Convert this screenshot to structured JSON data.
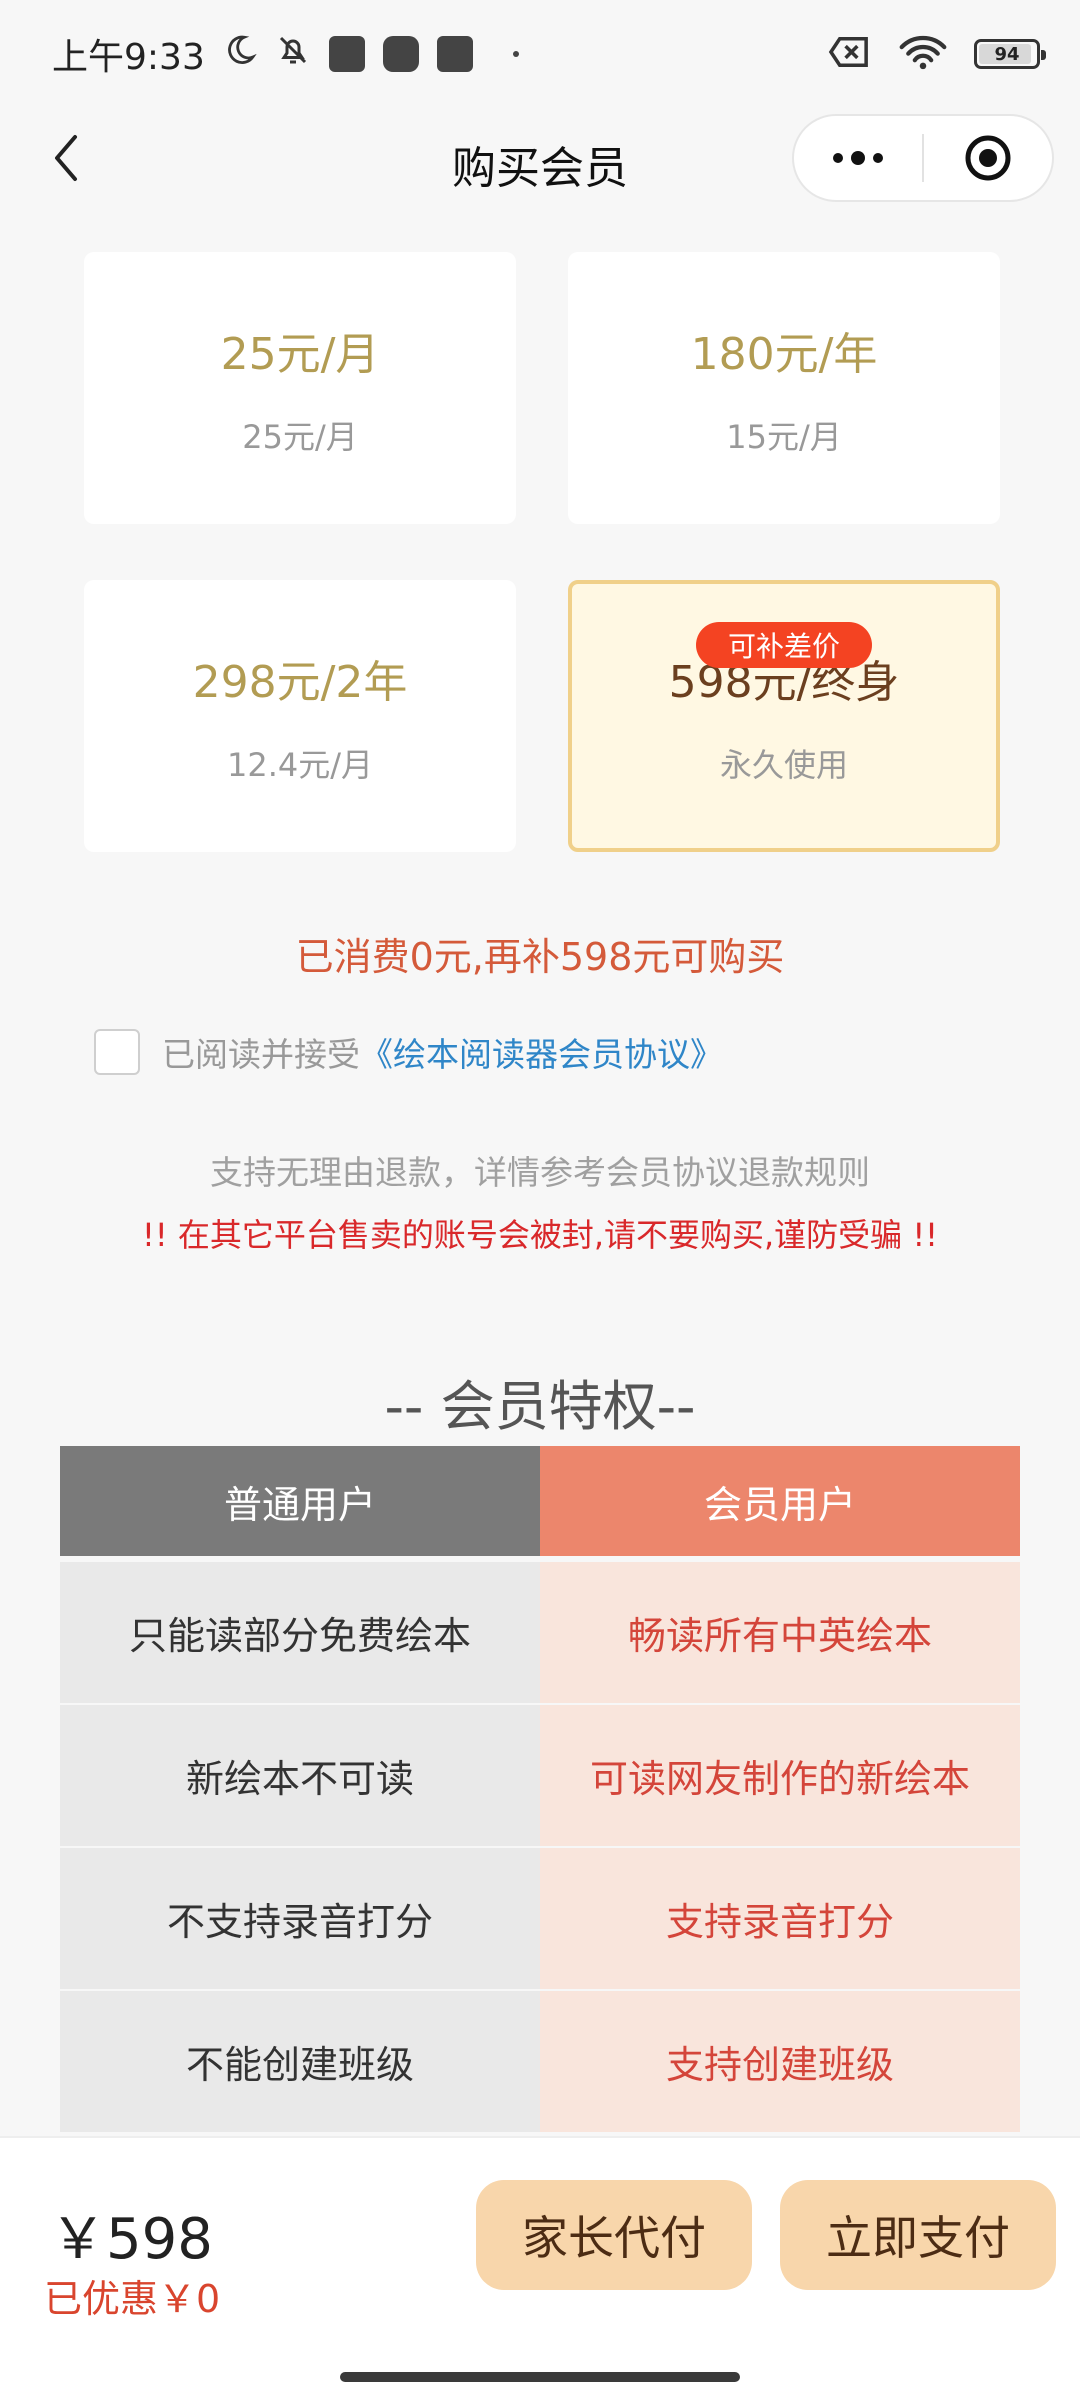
{
  "status_bar": {
    "time": "上午9:33",
    "battery": "94"
  },
  "nav": {
    "title": "购买会员"
  },
  "plans": [
    {
      "price": "25元/月",
      "sub": "25元/月"
    },
    {
      "price": "180元/年",
      "sub": "15元/月"
    },
    {
      "price": "298元/2年",
      "sub": "12.4元/月"
    },
    {
      "price": "598元/终身",
      "sub": "永久使用",
      "badge": "可补差价",
      "selected": true
    }
  ],
  "consumed_tip": "已消费0元,再补598元可购买",
  "agreement": {
    "prefix": "已阅读并接受",
    "link": "《绘本阅读器会员协议》"
  },
  "refund_tip": "支持无理由退款，详情参考会员协议退款规则",
  "warning_tip": "!! 在其它平台售卖的账号会被封,请不要购买,谨防受骗 !!",
  "privileges": {
    "title": "-- 会员特权--",
    "headers": [
      "普通用户",
      "会员用户"
    ],
    "rows": [
      [
        "只能读部分免费绘本",
        "畅读所有中英绘本"
      ],
      [
        "新绘本不可读",
        "可读网友制作的新绘本"
      ],
      [
        "不支持录音打分",
        "支持录音打分"
      ],
      [
        "不能创建班级",
        "支持创建班级"
      ]
    ]
  },
  "bottom": {
    "total": "￥598",
    "discount": "已优惠￥0",
    "parent_pay": "家长代付",
    "pay_now": "立即支付"
  },
  "colors": {
    "gold_price": "#b29c53",
    "selected_bg": "#fff8e3",
    "selected_border": "#f0d08a",
    "badge_red": "#f44322",
    "member_header": "#ec866c",
    "normal_header": "#7a7a7a",
    "button": "#f8d6ab"
  },
  "icons": [
    "moon-icon",
    "bell-off-icon",
    "wifi-icon",
    "sim-off-icon",
    "back-icon",
    "more-icon",
    "target-icon"
  ]
}
